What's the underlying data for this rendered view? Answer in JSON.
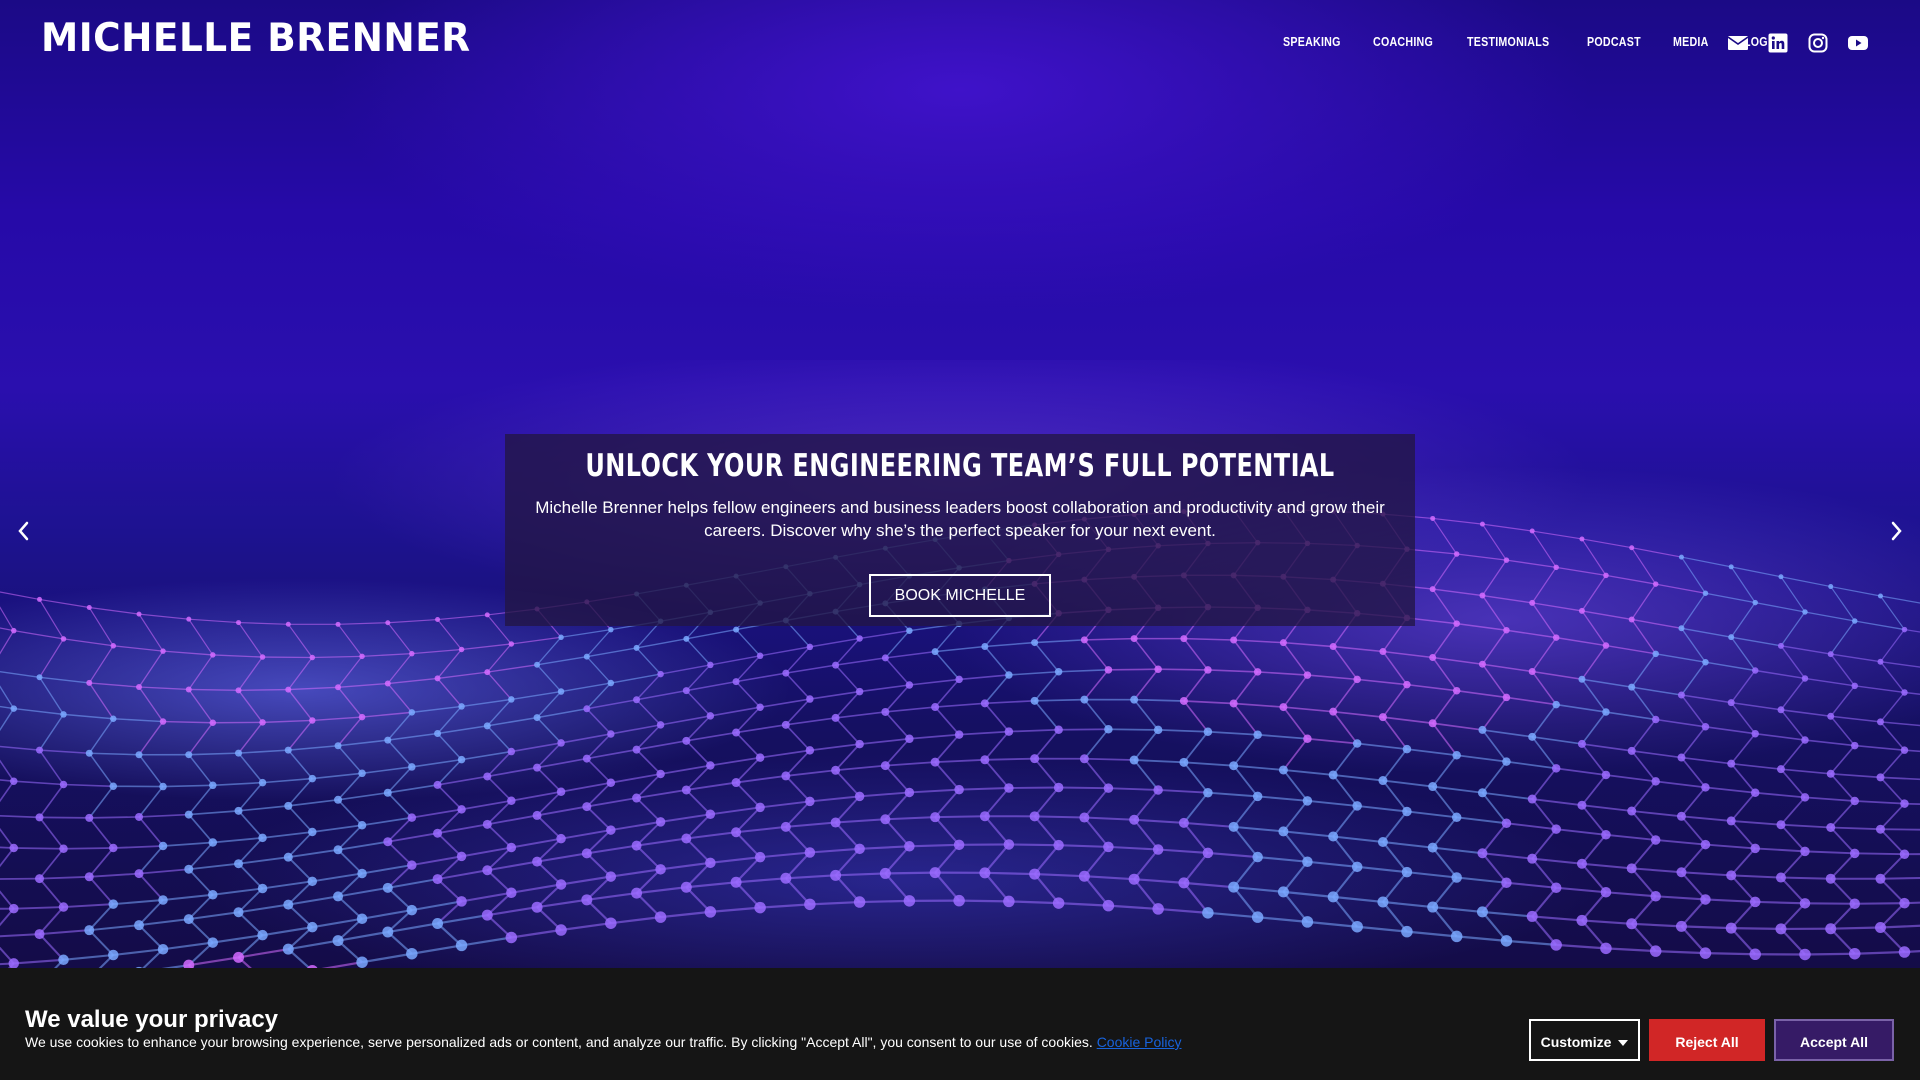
{
  "header": {
    "logo": "MICHELLE BRENNER",
    "nav": [
      "SPEAKING",
      "COACHING",
      "TESTIMONIALS",
      "PODCAST",
      "MEDIA",
      "BLOG"
    ],
    "social_icons": [
      "email-icon",
      "linkedin-icon",
      "instagram-icon",
      "youtube-icon"
    ]
  },
  "hero": {
    "title": "UNLOCK YOUR ENGINEERING TEAM’S FULL POTENTIAL",
    "description": "Michelle Brenner helps fellow engineers and business leaders boost collaboration and productivity and grow their careers. Discover why she’s the perfect speaker for your next event.",
    "cta_label": "BOOK MICHELLE",
    "prev_icon": "chevron-left-icon",
    "next_icon": "chevron-right-icon"
  },
  "cookie": {
    "title": "We value your privacy",
    "text": "We use cookies to enhance your browsing experience, serve personalized ads or content, and analyze our traffic. By clicking \"Accept All\", you consent to our use of cookies.",
    "policy_link": "Cookie Policy",
    "customize_label": "Customize",
    "reject_label": "Reject All",
    "accept_label": "Accept All"
  },
  "colors": {
    "hero_bg": "#2a0fae",
    "card_bg": "#221644",
    "cookie_bg": "#151515",
    "reject_bg": "#d12626",
    "accept_bg": "#361b66",
    "link": "#1863dc"
  }
}
